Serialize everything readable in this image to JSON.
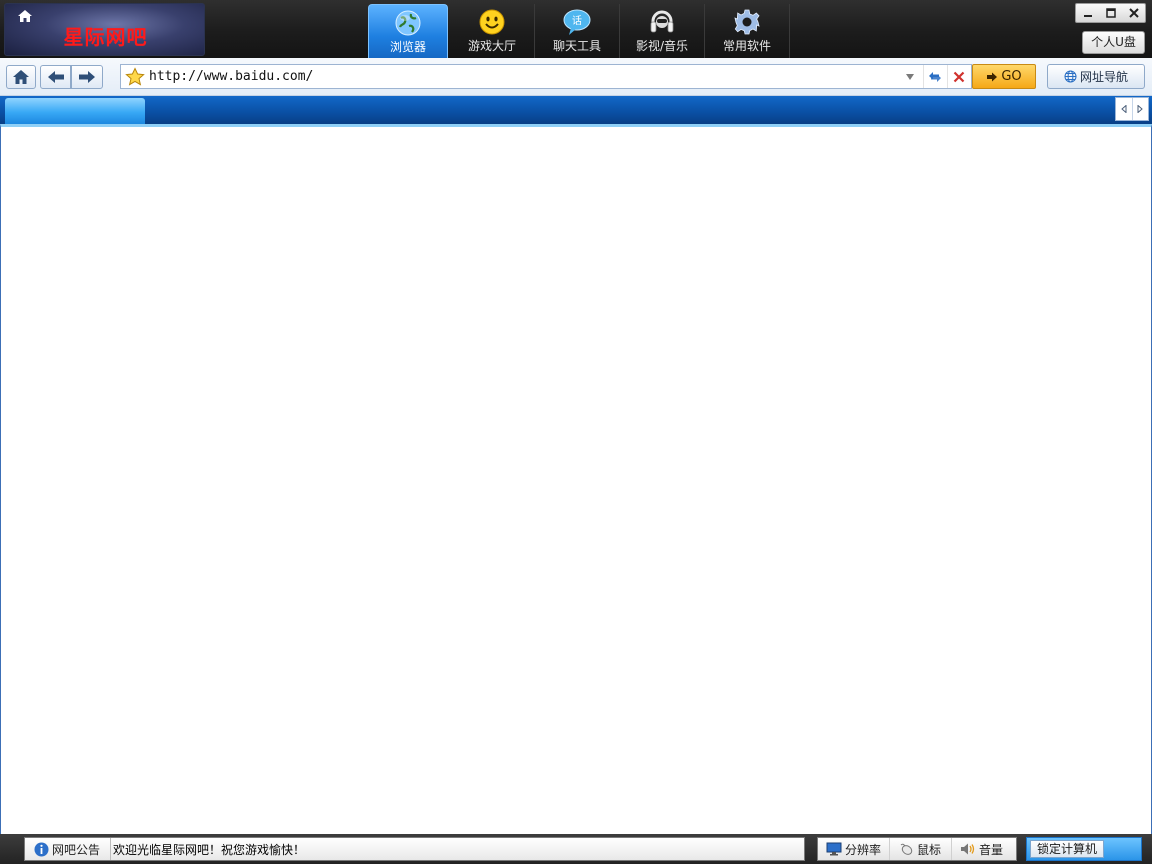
{
  "app": {
    "logo_text": "星际网吧"
  },
  "tabs": [
    {
      "label": "浏览器",
      "icon": "globe-icon",
      "active": true
    },
    {
      "label": "游戏大厅",
      "icon": "smiley-icon",
      "active": false
    },
    {
      "label": "聊天工具",
      "icon": "chat-bubble-icon",
      "active": false
    },
    {
      "label": "影视/音乐",
      "icon": "headphones-icon",
      "active": false
    },
    {
      "label": "常用软件",
      "icon": "gear-icon",
      "active": false
    }
  ],
  "window": {
    "udisk_label": "个人U盘"
  },
  "navbar": {
    "url": "http://www.baidu.com/",
    "go_label": "GO",
    "site_nav_label": "网址导航"
  },
  "statusbar": {
    "notice_label": "网吧公告",
    "notice_message": "欢迎光临星际网吧！祝您游戏愉快！",
    "resolution_label": "分辨率",
    "mouse_label": "鼠标",
    "volume_label": "音量",
    "lock_label": "锁定计算机"
  },
  "colors": {
    "accent": "#1e7fe0",
    "logo_text": "#ff1a1a",
    "go_button": "#f5a817"
  }
}
